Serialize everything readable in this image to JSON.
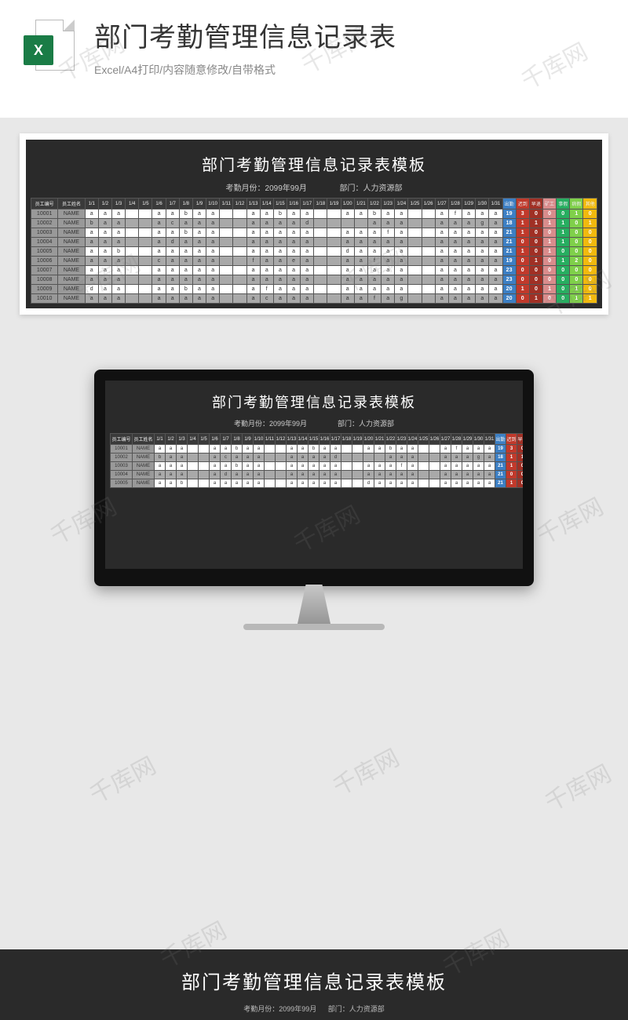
{
  "header": {
    "icon_letter": "X",
    "title": "部门考勤管理信息记录表",
    "subtitle": "Excel/A4打印/内容随意修改/自带格式"
  },
  "sheet": {
    "title": "部门考勤管理信息记录表模板",
    "month_label": "考勤月份：2099年99月",
    "dept_label": "部门：人力资源部",
    "head_empid": "员工编号",
    "head_empname": "员工姓名",
    "days": [
      "1/1",
      "1/2",
      "1/3",
      "1/4",
      "1/5",
      "1/6",
      "1/7",
      "1/8",
      "1/9",
      "1/10",
      "1/11",
      "1/12",
      "1/13",
      "1/14",
      "1/15",
      "1/16",
      "1/17",
      "1/18",
      "1/19",
      "1/20",
      "1/21",
      "1/22",
      "1/23",
      "1/24",
      "1/25",
      "1/26",
      "1/27",
      "1/28",
      "1/29",
      "1/30",
      "1/31"
    ],
    "sum_heads": [
      "出勤",
      "迟到",
      "早退",
      "矿工",
      "事假",
      "病假",
      "其他"
    ],
    "rows": [
      {
        "id": "10001",
        "name": "NAME",
        "d": [
          "a",
          "a",
          "a",
          "",
          "",
          "a",
          "a",
          "b",
          "a",
          "a",
          "",
          "",
          "a",
          "a",
          "b",
          "a",
          "a",
          "",
          "",
          "a",
          "a",
          "b",
          "a",
          "a",
          "",
          "",
          "a",
          "f",
          "a",
          "a",
          "a"
        ],
        "s": [
          19,
          3,
          0,
          0,
          0,
          1,
          0
        ]
      },
      {
        "id": "10002",
        "name": "NAME",
        "d": [
          "b",
          "a",
          "a",
          "",
          "",
          "a",
          "c",
          "a",
          "a",
          "a",
          "",
          "",
          "a",
          "a",
          "a",
          "a",
          "d",
          "",
          "",
          "",
          "",
          "a",
          "a",
          "a",
          "",
          "",
          "a",
          "a",
          "a",
          "g",
          "a"
        ],
        "s": [
          18,
          1,
          1,
          1,
          1,
          0,
          1
        ]
      },
      {
        "id": "10003",
        "name": "NAME",
        "d": [
          "a",
          "a",
          "a",
          "",
          "",
          "a",
          "a",
          "b",
          "a",
          "a",
          "",
          "",
          "a",
          "a",
          "a",
          "a",
          "a",
          "",
          "",
          "a",
          "a",
          "a",
          "f",
          "a",
          "",
          "",
          "a",
          "a",
          "a",
          "a",
          "a"
        ],
        "s": [
          21,
          1,
          0,
          0,
          1,
          0,
          0
        ]
      },
      {
        "id": "10004",
        "name": "NAME",
        "d": [
          "a",
          "a",
          "a",
          "",
          "",
          "a",
          "d",
          "a",
          "a",
          "a",
          "",
          "",
          "a",
          "a",
          "a",
          "a",
          "a",
          "",
          "",
          "a",
          "a",
          "a",
          "a",
          "a",
          "",
          "",
          "a",
          "a",
          "a",
          "a",
          "a"
        ],
        "s": [
          21,
          0,
          0,
          1,
          1,
          0,
          0
        ]
      },
      {
        "id": "10005",
        "name": "NAME",
        "d": [
          "a",
          "a",
          "b",
          "",
          "",
          "a",
          "a",
          "a",
          "a",
          "a",
          "",
          "",
          "a",
          "a",
          "a",
          "a",
          "a",
          "",
          "",
          "d",
          "a",
          "a",
          "a",
          "a",
          "",
          "",
          "a",
          "a",
          "a",
          "a",
          "a"
        ],
        "s": [
          21,
          1,
          0,
          1,
          0,
          0,
          0
        ]
      },
      {
        "id": "10006",
        "name": "NAME",
        "d": [
          "a",
          "a",
          "a",
          "",
          "",
          "c",
          "a",
          "a",
          "a",
          "a",
          "",
          "",
          "f",
          "a",
          "a",
          "e",
          "a",
          "",
          "",
          "a",
          "a",
          "f",
          "a",
          "a",
          "",
          "",
          "a",
          "a",
          "a",
          "a",
          "a"
        ],
        "s": [
          19,
          0,
          1,
          0,
          1,
          2,
          0
        ]
      },
      {
        "id": "10007",
        "name": "NAME",
        "d": [
          "a",
          "a",
          "a",
          "",
          "",
          "a",
          "a",
          "a",
          "a",
          "a",
          "",
          "",
          "a",
          "a",
          "a",
          "a",
          "a",
          "",
          "",
          "a",
          "a",
          "a",
          "a",
          "a",
          "",
          "",
          "a",
          "a",
          "a",
          "a",
          "a"
        ],
        "s": [
          23,
          0,
          0,
          0,
          0,
          0,
          0
        ]
      },
      {
        "id": "10008",
        "name": "NAME",
        "d": [
          "a",
          "a",
          "a",
          "",
          "",
          "a",
          "a",
          "a",
          "a",
          "a",
          "",
          "",
          "a",
          "a",
          "a",
          "a",
          "a",
          "",
          "",
          "a",
          "a",
          "a",
          "a",
          "a",
          "",
          "",
          "a",
          "a",
          "a",
          "a",
          "a"
        ],
        "s": [
          23,
          0,
          0,
          0,
          0,
          0,
          0
        ]
      },
      {
        "id": "10009",
        "name": "NAME",
        "d": [
          "d",
          "a",
          "a",
          "",
          "",
          "a",
          "a",
          "b",
          "a",
          "a",
          "",
          "",
          "a",
          "f",
          "a",
          "a",
          "a",
          "",
          "",
          "a",
          "a",
          "a",
          "a",
          "a",
          "",
          "",
          "a",
          "a",
          "a",
          "a",
          "a"
        ],
        "s": [
          20,
          1,
          0,
          1,
          0,
          1,
          0
        ]
      },
      {
        "id": "10010",
        "name": "NAME",
        "d": [
          "a",
          "a",
          "a",
          "",
          "",
          "a",
          "a",
          "a",
          "a",
          "a",
          "",
          "",
          "a",
          "c",
          "a",
          "a",
          "a",
          "",
          "",
          "a",
          "a",
          "f",
          "a",
          "g",
          "",
          "",
          "a",
          "a",
          "a",
          "a",
          "a"
        ],
        "s": [
          20,
          0,
          1,
          0,
          0,
          1,
          1
        ]
      }
    ]
  },
  "bottom": {
    "title": "部门考勤管理信息记录表模板",
    "sub": "考勤月份：2099年99月    部门：人力资源部"
  },
  "watermark": "千库网",
  "colors": {
    "sum_classes": [
      "c-blue",
      "c-red",
      "c-dred",
      "c-pink",
      "c-green",
      "c-lgreen",
      "c-yellow"
    ]
  }
}
